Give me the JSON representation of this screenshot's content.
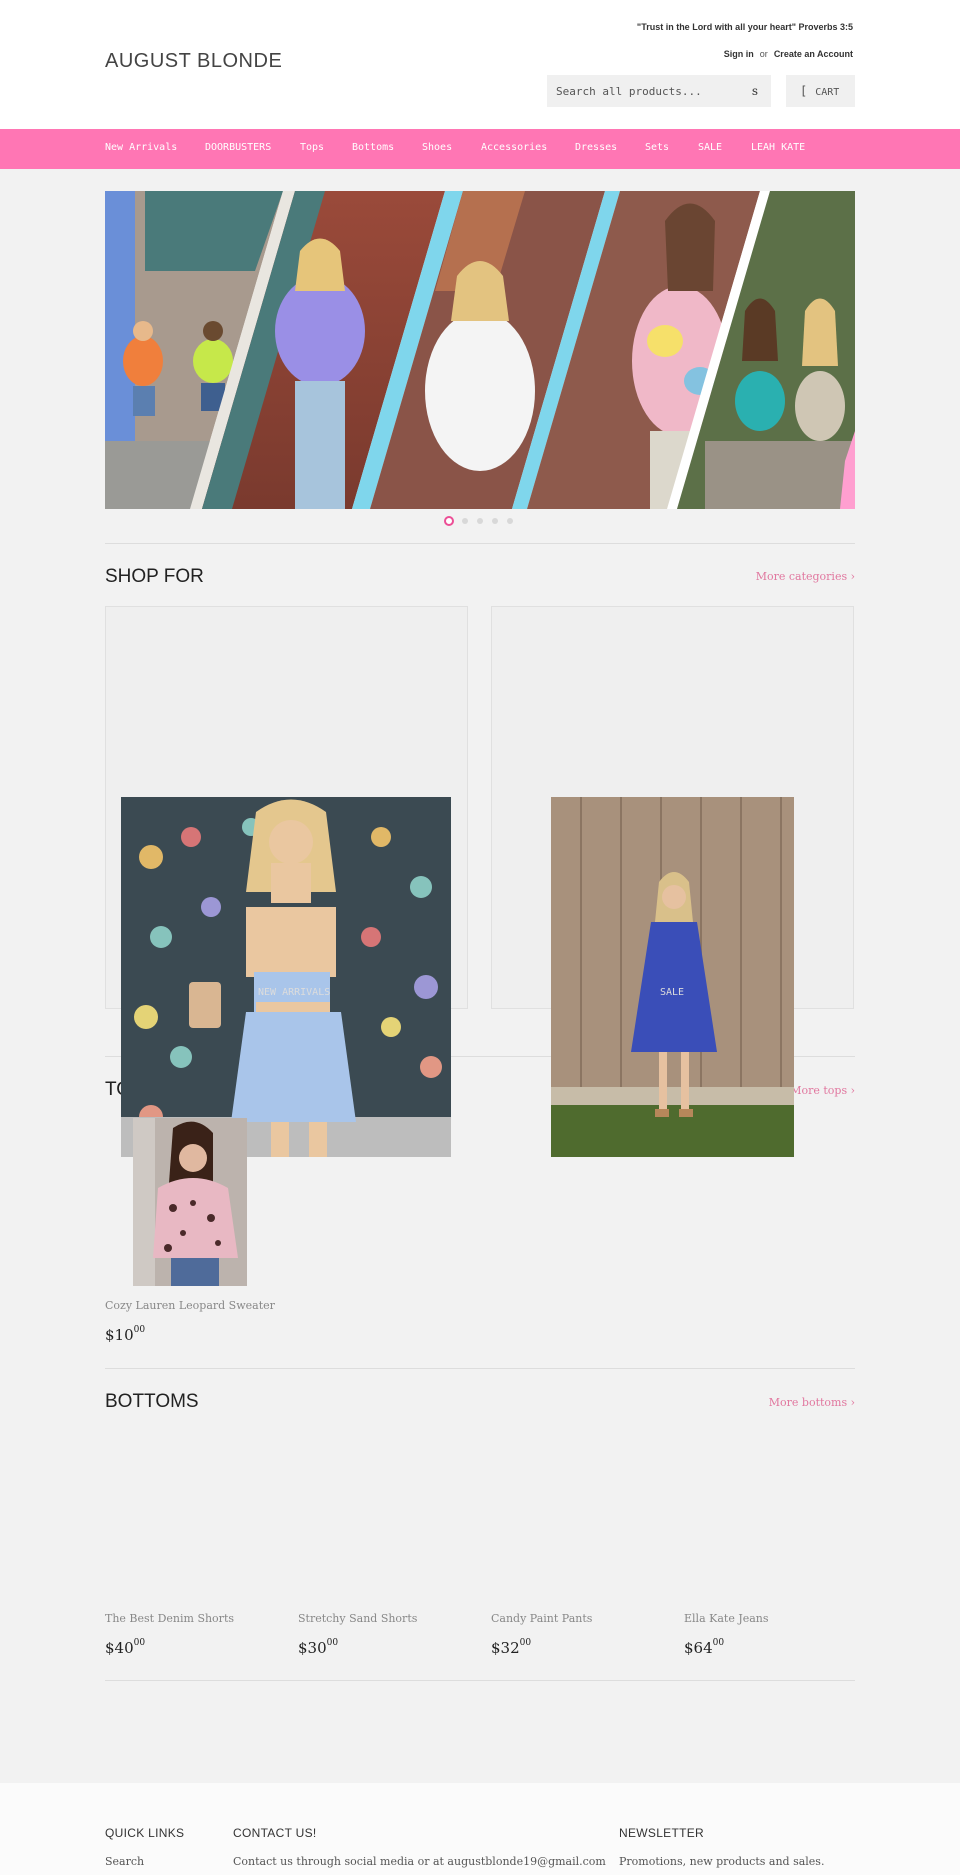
{
  "header": {
    "logo": "AUGUST BLONDE",
    "quote": "\"Trust in the Lord with all your heart\" Proverbs 3:5",
    "sign_in": "Sign in",
    "or": "or",
    "create_account": "Create an Account",
    "search_placeholder": "Search all products...",
    "search_button_glyph": "s",
    "cart_glyph": "[",
    "cart_label": "CART"
  },
  "nav": {
    "items": [
      "New Arrivals",
      "DOORBUSTERS",
      "Tops",
      "Bottoms",
      "Shoes",
      "Accessories",
      "Dresses",
      "Sets",
      "SALE",
      "LEAH KATE"
    ]
  },
  "hero": {
    "slide_count": 5,
    "active_slide": 1
  },
  "shop_for": {
    "title": "SHOP FOR",
    "more": "More categories ›",
    "cards": [
      "NEW ARRIVALS",
      "SALE"
    ]
  },
  "tops": {
    "title": "TOPS",
    "more": "More tops ›",
    "products": [
      {
        "name": "Cozy Lauren Leopard Sweater",
        "price_main": "$10",
        "price_cents": "00"
      }
    ]
  },
  "bottoms": {
    "title": "BOTTOMS",
    "more": "More bottoms ›",
    "products": [
      {
        "name": "The Best Denim Shorts",
        "price_main": "$40",
        "price_cents": "00"
      },
      {
        "name": "Stretchy Sand Shorts",
        "price_main": "$30",
        "price_cents": "00"
      },
      {
        "name": "Candy Paint Pants",
        "price_main": "$32",
        "price_cents": "00"
      },
      {
        "name": "Ella Kate Jeans",
        "price_main": "$64",
        "price_cents": "00"
      }
    ]
  },
  "footer": {
    "quick_links_title": "QUICK LINKS",
    "quick_links_first": "Search",
    "contact_title": "CONTACT US!",
    "contact_text": "Contact us through social media or at augustblonde19@gmail.com",
    "newsletter_title": "NEWSLETTER",
    "newsletter_text": "Promotions, new products and sales."
  },
  "colors": {
    "nav_bg": "#ff76b4",
    "link": "#e1779f",
    "page_bg": "#f2f2f2"
  }
}
